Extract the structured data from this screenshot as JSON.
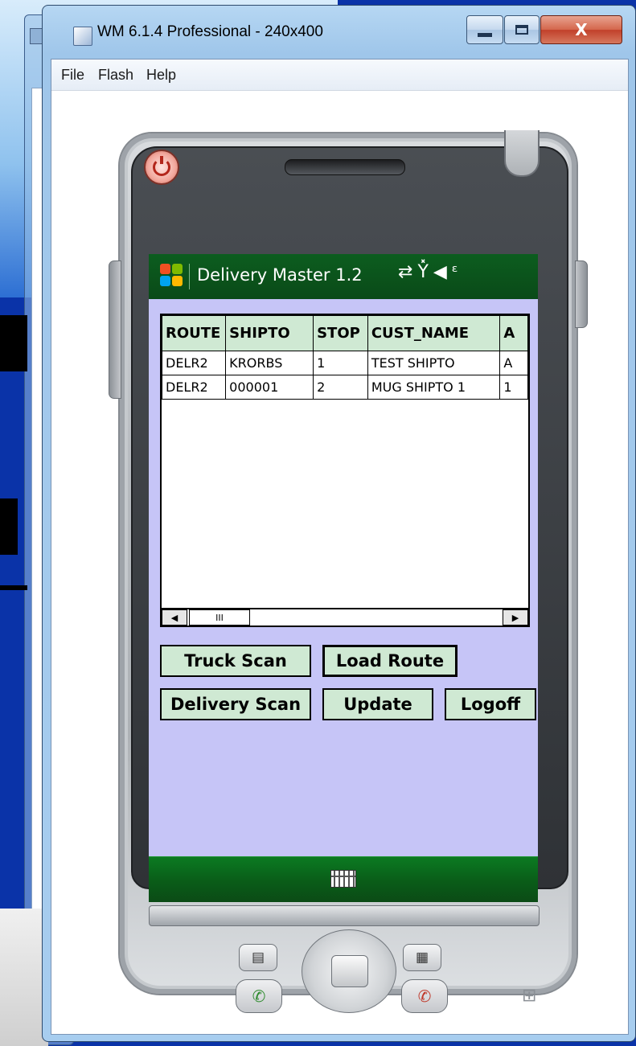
{
  "window": {
    "title": "WM 6.1.4 Professional - 240x400",
    "minimize_label": "",
    "maximize_label": "",
    "close_label": "X"
  },
  "menu": {
    "items": [
      "File",
      "Flash",
      "Help"
    ]
  },
  "device": {
    "status_bar": {
      "app_title": "Delivery Master 1.2",
      "icons": [
        "connectivity-icon",
        "no-signal-icon",
        "speaker-muted-icon"
      ]
    },
    "grid": {
      "columns": [
        "ROUTE",
        "SHIPTO",
        "STOP",
        "CUST_NAME",
        "A"
      ],
      "rows": [
        [
          "DELR2",
          "KRORBS",
          "1",
          "TEST SHIPTO",
          "A"
        ],
        [
          "DELR2",
          "000001",
          "2",
          "MUG SHIPTO 1",
          "1"
        ]
      ],
      "scroll_thumb": "III"
    },
    "buttons": {
      "truck_scan": "Truck Scan",
      "load_route": "Load Route",
      "delivery_scan": "Delivery Scan",
      "update": "Update",
      "logoff": "Logoff"
    },
    "softkey": {
      "icon": "keyboard-icon"
    }
  },
  "colors": {
    "desktop": "#0a33a8",
    "screen_bg": "#c6c5f7",
    "status_bar": "#0c5d1f",
    "button_bg": "#cfe9d3",
    "softkey_bar": "#0b7a22"
  }
}
